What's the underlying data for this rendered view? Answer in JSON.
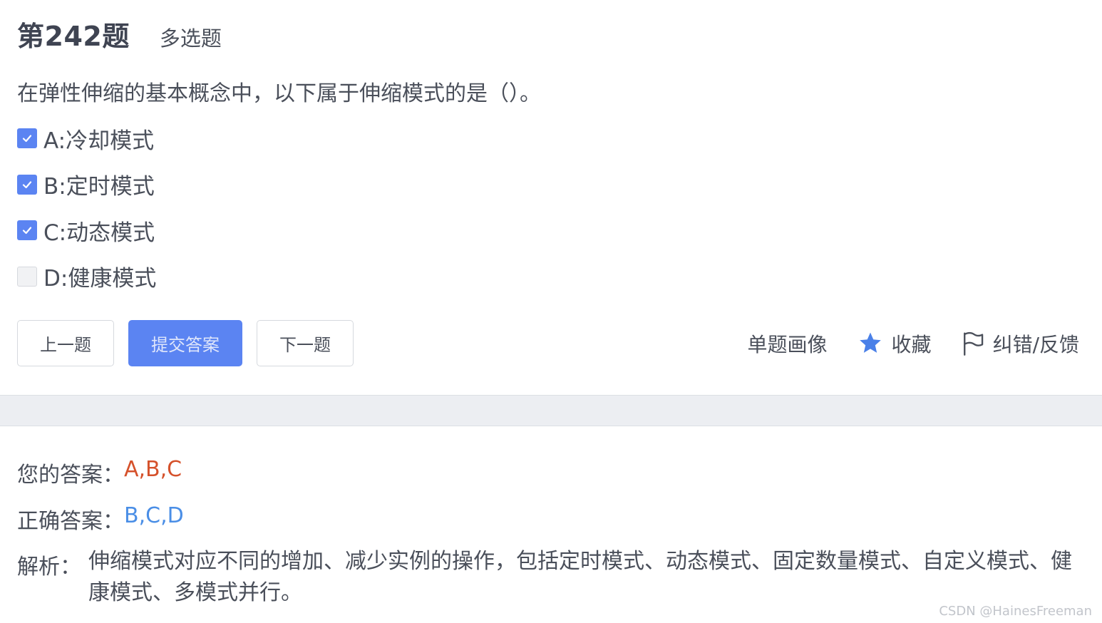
{
  "question": {
    "number": "第242题",
    "type": "多选题",
    "stem": "在弹性伸缩的基本概念中，以下属于伸缩模式的是（）。"
  },
  "options": [
    {
      "label": "A:冷却模式",
      "checked": true
    },
    {
      "label": "B:定时模式",
      "checked": true
    },
    {
      "label": "C:动态模式",
      "checked": true
    },
    {
      "label": "D:健康模式",
      "checked": false
    }
  ],
  "buttons": {
    "prev": "上一题",
    "submit": "提交答案",
    "next": "下一题"
  },
  "actions": {
    "portrait": "单题画像",
    "favorite": "收藏",
    "feedback": "纠错/反馈"
  },
  "answer": {
    "yours_label": "您的答案：",
    "yours_value": "A,B,C",
    "correct_label": "正确答案：",
    "correct_value": "B,C,D",
    "analysis_label": "解析：",
    "analysis_text": "伸缩模式对应不同的增加、减少实例的操作，包括定时模式、动态模式、固定数量模式、自定义模式、健康模式、多模式并行。"
  },
  "watermark": "CSDN @HainesFreeman",
  "colors": {
    "accent": "#5b84f2",
    "wrong_answer": "#d5512b",
    "correct_answer": "#4a8ee6",
    "star": "#4a80e8"
  }
}
